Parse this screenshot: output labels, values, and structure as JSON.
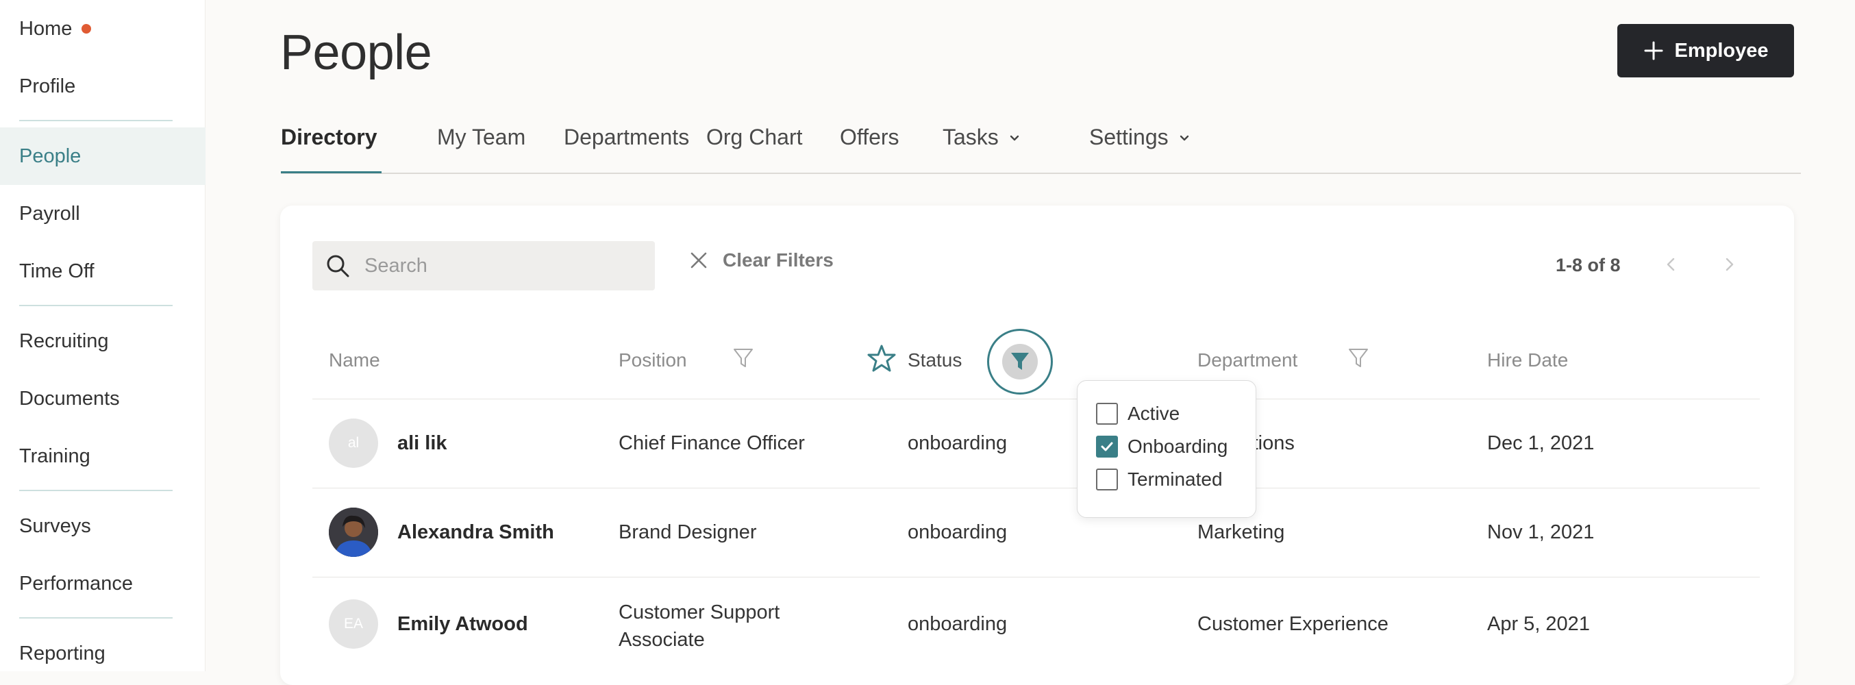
{
  "colors": {
    "accent": "#3a7f87",
    "dark_button": "#25262a",
    "notification_dot": "#e05b33"
  },
  "sidebar": {
    "items": [
      {
        "label": "Home",
        "has_dot": true
      },
      {
        "label": "Profile"
      },
      {
        "label": "People",
        "active": true
      },
      {
        "label": "Payroll"
      },
      {
        "label": "Time Off"
      },
      {
        "label": "Recruiting"
      },
      {
        "label": "Documents"
      },
      {
        "label": "Training"
      },
      {
        "label": "Surveys"
      },
      {
        "label": "Performance"
      },
      {
        "label": "Reporting"
      }
    ]
  },
  "header": {
    "title": "People",
    "add_button_label": "Employee",
    "add_button_icon": "plus-icon"
  },
  "tabs": [
    {
      "label": "Directory",
      "active": true
    },
    {
      "label": "My Team"
    },
    {
      "label": "Departments"
    },
    {
      "label": "Org Chart"
    },
    {
      "label": "Offers"
    },
    {
      "label": "Tasks",
      "dropdown": true
    },
    {
      "label": "Settings",
      "dropdown": true
    }
  ],
  "toolbar": {
    "search_placeholder": "Search",
    "clear_filters_label": "Clear Filters",
    "pagination_text": "1-8 of 8"
  },
  "table": {
    "columns": [
      "Name",
      "Position",
      "Status",
      "Department",
      "Hire Date"
    ],
    "rows": [
      {
        "initials": "al",
        "name": "ali lik",
        "position": "Chief Finance Officer",
        "status": "onboarding",
        "department": "Operations",
        "hire_date": "Dec 1, 2021",
        "avatar": "initials"
      },
      {
        "initials": "",
        "name": "Alexandra Smith",
        "position": "Brand Designer",
        "status": "onboarding",
        "department": "Marketing",
        "hire_date": "Nov 1, 2021",
        "avatar": "photo"
      },
      {
        "initials": "EA",
        "name": "Emily Atwood",
        "position_line1": "Customer Support",
        "position_line2": "Associate",
        "status": "onboarding",
        "department": "Customer Experience",
        "hire_date": "Apr 5, 2021",
        "avatar": "initials"
      }
    ]
  },
  "status_filter": {
    "options": [
      {
        "label": "Active",
        "checked": false
      },
      {
        "label": "Onboarding",
        "checked": true
      },
      {
        "label": "Terminated",
        "checked": false
      }
    ]
  }
}
